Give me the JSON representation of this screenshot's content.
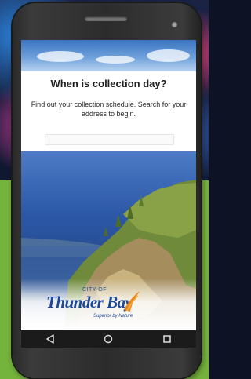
{
  "app": {
    "heading": "When is collection day?",
    "description": "Find out your collection schedule. Search for your address to begin.",
    "search_placeholder": ""
  },
  "logo": {
    "city_of": "CITY OF",
    "name": "Thunder Bay",
    "tagline": "Superior by Nature",
    "colors": {
      "blue": "#1c4799",
      "orange": "#e88a1c"
    }
  },
  "nav": {
    "back_icon": "back-triangle-icon",
    "home_icon": "home-circle-icon",
    "recents_icon": "recents-square-icon"
  },
  "colors": {
    "background_green": "#74b33c",
    "phone_body": "#2c2c2c",
    "navbar": "#1b1b1b"
  }
}
